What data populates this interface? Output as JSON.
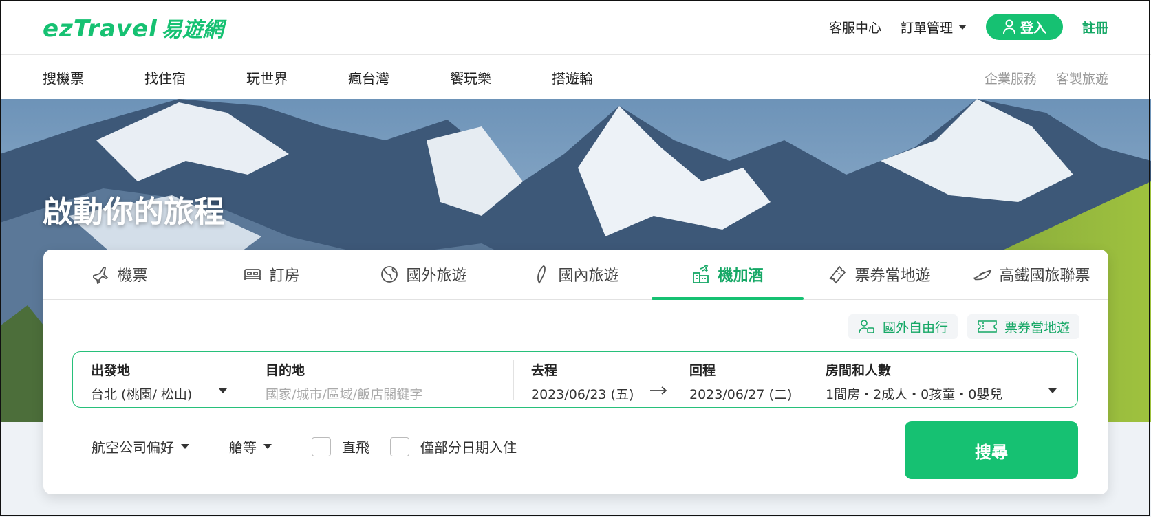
{
  "header": {
    "logo_brand": "ezTravel",
    "logo_cn": "易遊網",
    "service_center": "客服中心",
    "order_manage": "訂單管理",
    "login": "登入",
    "register": "註冊"
  },
  "nav": {
    "items": [
      "搜機票",
      "找住宿",
      "玩世界",
      "瘋台灣",
      "饗玩樂",
      "搭遊輪"
    ],
    "right": [
      "企業服務",
      "客製旅遊"
    ]
  },
  "hero": {
    "title": "啟動你的旅程"
  },
  "tabs": [
    {
      "label": "機票",
      "icon": "airplane-icon"
    },
    {
      "label": "訂房",
      "icon": "bed-icon"
    },
    {
      "label": "國外旅遊",
      "icon": "globe-icon"
    },
    {
      "label": "國內旅遊",
      "icon": "taiwan-icon"
    },
    {
      "label": "機加酒",
      "icon": "flight-hotel-icon",
      "active": true
    },
    {
      "label": "票券當地遊",
      "icon": "ticket-icon"
    },
    {
      "label": "高鐵國旅聯票",
      "icon": "train-icon"
    }
  ],
  "chips": {
    "independent": "國外自由行",
    "tickets": "票券當地遊"
  },
  "form": {
    "origin_label": "出發地",
    "origin_value": "台北 (桃園/ 松山)",
    "dest_label": "目的地",
    "dest_placeholder": "國家/城市/區域/飯店關鍵字",
    "depart_label": "去程",
    "depart_value": "2023/06/23 (五)",
    "return_label": "回程",
    "return_value": "2023/06/27 (二)",
    "rooms_label": "房間和人數",
    "rooms_value": "1間房・2成人・0孩童・0嬰兒"
  },
  "options": {
    "airline_pref": "航空公司偏好",
    "cabin": "艙等",
    "direct": "直飛",
    "partial_checkin": "僅部分日期入住"
  },
  "search_button": "搜尋",
  "colors": {
    "brand_green": "#16c172",
    "text_green": "#16a866"
  }
}
